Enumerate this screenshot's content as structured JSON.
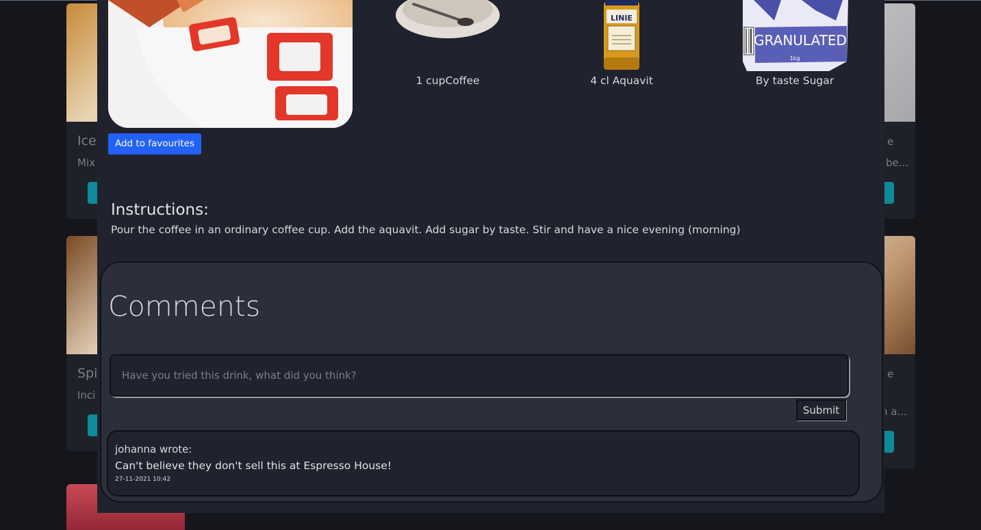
{
  "background_cards": {
    "left": [
      {
        "title": "Ice",
        "desc": "Mix"
      },
      {
        "title": "Spi",
        "desc": "Inci"
      }
    ],
    "right": [
      {
        "title": "e",
        "desc": "be..."
      },
      {
        "title": "e",
        "desc": "n a..."
      }
    ]
  },
  "drink": {
    "favourite_button": "Add to favourites",
    "ingredients": [
      {
        "label": "1 cupCoffee",
        "icon": "coffee-cup-icon"
      },
      {
        "label": "4 cl Aquavit",
        "icon": "aquavit-bottle-icon"
      },
      {
        "label": "By taste Sugar",
        "icon": "sugar-bag-icon"
      }
    ],
    "sugar_bag_text": "GRANULATED",
    "sugar_bag_weight": "1kg",
    "aquavit_label_text": "LINIE",
    "instructions_title": "Instructions:",
    "instructions_text": "Pour the coffee in an ordinary coffee cup. Add the aquavit. Add sugar by taste. Stir and have a nice evening (morning)"
  },
  "comments": {
    "title": "Comments",
    "input_placeholder": "Have you tried this drink, what did you think?",
    "submit_label": "Submit",
    "items": [
      {
        "author": "johanna wrote:",
        "text": "Can't believe they don't sell this at Espresso House!",
        "date": "27-11-2021 10:42"
      }
    ]
  },
  "colors": {
    "page_bg": "#14161c",
    "modal_bg": "#20232e",
    "comments_bg": "#2b2e3b",
    "accent_blue": "#2261f4",
    "accent_teal": "#0f8a99"
  }
}
